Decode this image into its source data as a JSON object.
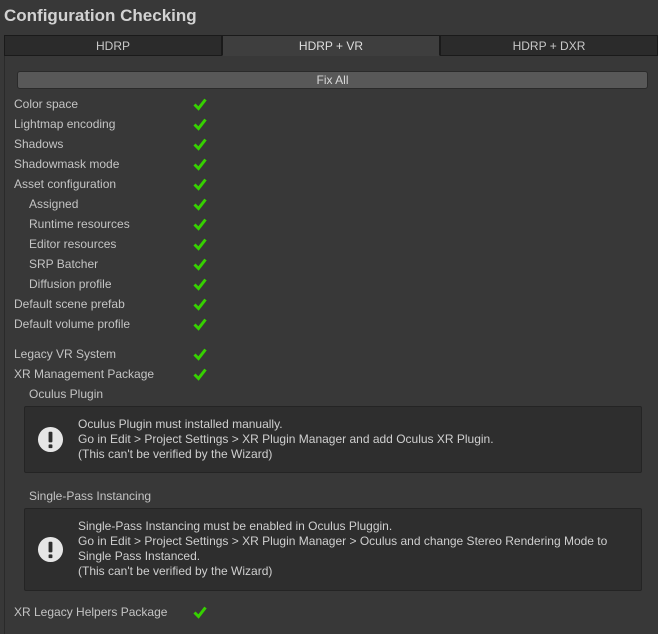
{
  "window": {
    "title": "Configuration Checking"
  },
  "tabs": [
    {
      "label": "HDRP",
      "active": false
    },
    {
      "label": "HDRP + VR",
      "active": true
    },
    {
      "label": "HDRP + DXR",
      "active": false
    }
  ],
  "fix_all_label": "Fix All",
  "checks": [
    {
      "label": "Color space",
      "status": "ok"
    },
    {
      "label": "Lightmap encoding",
      "status": "ok"
    },
    {
      "label": "Shadows",
      "status": "ok"
    },
    {
      "label": "Shadowmask mode",
      "status": "ok"
    },
    {
      "label": "Asset configuration",
      "status": "ok"
    },
    {
      "label": "Assigned",
      "status": "ok"
    },
    {
      "label": "Runtime resources",
      "status": "ok"
    },
    {
      "label": "Editor resources",
      "status": "ok"
    },
    {
      "label": "SRP Batcher",
      "status": "ok"
    },
    {
      "label": "Diffusion profile",
      "status": "ok"
    },
    {
      "label": "Default scene prefab",
      "status": "ok"
    },
    {
      "label": "Default volume profile",
      "status": "ok"
    }
  ],
  "vr_checks": [
    {
      "label": "Legacy VR System",
      "status": "ok"
    },
    {
      "label": "XR Management Package",
      "status": "ok"
    }
  ],
  "oculus": {
    "label": "Oculus Plugin",
    "lines": [
      "Oculus Plugin must installed manually.",
      "Go in Edit > Project Settings > XR Plugin Manager and add Oculus XR Plugin.",
      "(This can't be verified by the Wizard)"
    ]
  },
  "spi": {
    "label": "Single-Pass Instancing",
    "lines": [
      "Single-Pass Instancing must be enabled in Oculus Pluggin.",
      "Go in Edit > Project Settings > XR Plugin Manager > Oculus and change Stereo Rendering Mode to Single Pass Instanced.",
      "(This can't be verified by the Wizard)"
    ]
  },
  "legacy_helpers": {
    "label": "XR Legacy Helpers Package",
    "status": "ok"
  },
  "colors": {
    "check_green": "#36d100",
    "background": "#383838"
  }
}
